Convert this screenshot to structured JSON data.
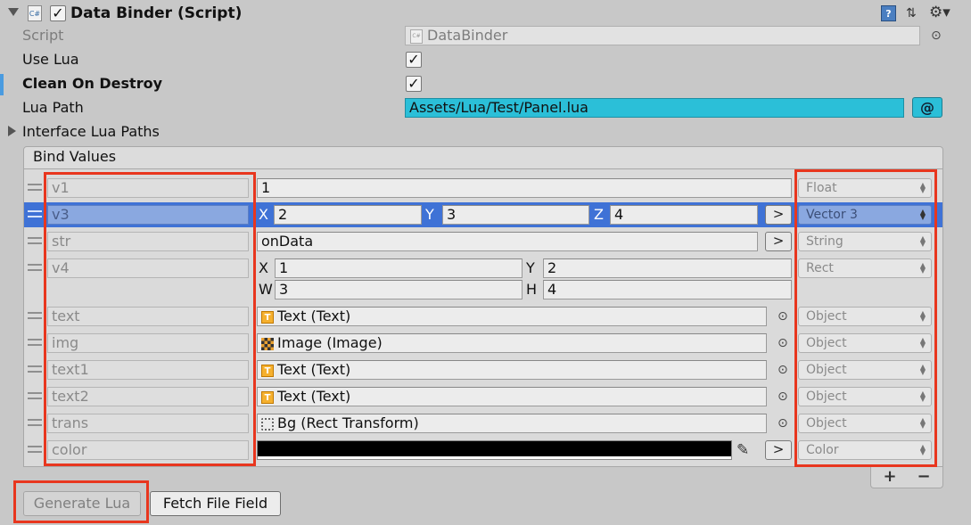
{
  "component": {
    "title": "Data Binder (Script)",
    "enabled": true,
    "script_label": "Script",
    "script_value": "DataBinder"
  },
  "props": {
    "use_lua_label": "Use Lua",
    "use_lua_checked": true,
    "clean_label": "Clean On Destroy",
    "clean_checked": true,
    "lua_path_label": "Lua Path",
    "lua_path_value": "Assets/Lua/Test/Panel.lua",
    "lua_path_button": "@",
    "interface_label": "Interface Lua Paths"
  },
  "bind_values": {
    "header": "Bind Values",
    "rows": {
      "v1": {
        "key": "v1",
        "value": "1",
        "type": "Float"
      },
      "v3": {
        "key": "v3",
        "x_label": "X",
        "x": "2",
        "y_label": "Y",
        "y": "3",
        "z_label": "Z",
        "z": "4",
        "type": "Vector 3",
        "arrow": ">"
      },
      "str": {
        "key": "str",
        "value": "onData",
        "type": "String",
        "arrow": ">"
      },
      "v4": {
        "key": "v4",
        "x_label": "X",
        "x": "1",
        "y_label": "Y",
        "y": "2",
        "w_label": "W",
        "w": "3",
        "h_label": "H",
        "h": "4",
        "type": "Rect"
      },
      "text": {
        "key": "text",
        "value": "Text (Text)",
        "type": "Object"
      },
      "img": {
        "key": "img",
        "value": "Image (Image)",
        "type": "Object"
      },
      "text1": {
        "key": "text1",
        "value": "Text (Text)",
        "type": "Object"
      },
      "text2": {
        "key": "text2",
        "value": "Text (Text)",
        "type": "Object"
      },
      "trans": {
        "key": "trans",
        "value": "Bg (Rect Transform)",
        "type": "Object"
      },
      "color": {
        "key": "color",
        "type": "Color",
        "arrow": ">",
        "swatch": "#000000"
      }
    },
    "add_label": "+",
    "remove_label": "−"
  },
  "buttons": {
    "generate": "Generate Lua",
    "fetch": "Fetch File Field"
  },
  "icons": {
    "foldout": "triangle-down",
    "script": "csharp-script-icon",
    "help": "help-book-icon",
    "presets": "presets-icon",
    "settings": "gear-icon",
    "object_picker": "circle-dot"
  },
  "colors": {
    "selected_row": "#3f72d6",
    "lua_path_bg": "#2bbfd8",
    "highlight_box": "#e8361e",
    "swatch": "#000000"
  }
}
